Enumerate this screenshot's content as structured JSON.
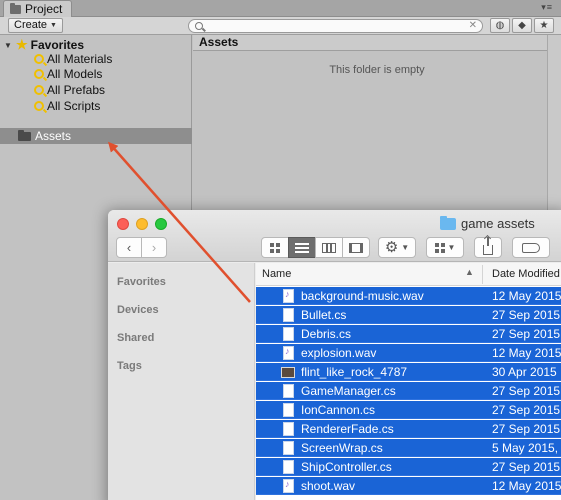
{
  "unity": {
    "tab_label": "Project",
    "create_label": "Create",
    "favorites_label": "Favorites",
    "favorites": [
      {
        "label": "All Materials"
      },
      {
        "label": "All Models"
      },
      {
        "label": "All Prefabs"
      },
      {
        "label": "All Scripts"
      }
    ],
    "assets_label": "Assets",
    "content_header": "Assets",
    "empty_message": "This folder is empty"
  },
  "finder": {
    "title": "game assets",
    "sidebar": [
      "Favorites",
      "Devices",
      "Shared",
      "Tags"
    ],
    "columns": {
      "name": "Name",
      "date": "Date Modified"
    },
    "files": [
      {
        "name": "background-music.wav",
        "date": "12 May 2015",
        "kind": "wav"
      },
      {
        "name": "Bullet.cs",
        "date": "27 Sep 2015",
        "kind": "cs"
      },
      {
        "name": "Debris.cs",
        "date": "27 Sep 2015",
        "kind": "cs"
      },
      {
        "name": "explosion.wav",
        "date": "12 May 2015",
        "kind": "wav"
      },
      {
        "name": "flint_like_rock_4787",
        "date": "30 Apr 2015",
        "kind": "img"
      },
      {
        "name": "GameManager.cs",
        "date": "27 Sep 2015",
        "kind": "cs"
      },
      {
        "name": "IonCannon.cs",
        "date": "27 Sep 2015",
        "kind": "cs"
      },
      {
        "name": "RendererFade.cs",
        "date": "27 Sep 2015",
        "kind": "cs"
      },
      {
        "name": "ScreenWrap.cs",
        "date": "5 May 2015,",
        "kind": "cs"
      },
      {
        "name": "ShipController.cs",
        "date": "27 Sep 2015",
        "kind": "cs"
      },
      {
        "name": "shoot.wav",
        "date": "12 May 2015",
        "kind": "wav"
      }
    ]
  },
  "colors": {
    "selection": "#1a64d6",
    "arrow": "#e0502e",
    "unity_bg": "#c2c2c2"
  }
}
